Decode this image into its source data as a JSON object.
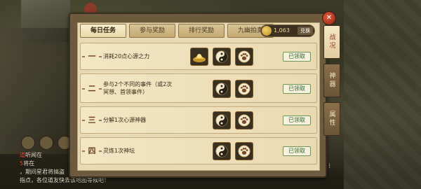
{
  "scene": {
    "chat": {
      "lines": [
        {
          "prefix": "道",
          "text": "听闻在",
          "red": "",
          "extra": ""
        },
        {
          "prefix": "5",
          "text": "将在",
          "red": "",
          "extra": ""
        },
        {
          "prefix": "",
          "text": "，期间星君将搞盗",
          "red": "",
          "extra": ""
        },
        {
          "prefix": "",
          "text": "指点，各位道友快去该地图等候吧！",
          "red": "",
          "extra": ""
        }
      ]
    }
  },
  "panel": {
    "tabs": [
      {
        "label": "每日任务",
        "active": true
      },
      {
        "label": "参与奖励",
        "active": false
      },
      {
        "label": "排行奖励",
        "active": false
      },
      {
        "label": "九幽拍卖",
        "active": false
      }
    ],
    "currency": {
      "value": "1,063",
      "button": "兑换"
    },
    "tasks": [
      {
        "num": "一",
        "title_lines": [
          "消耗20点心源之力"
        ],
        "rewards": [
          "gold-ingot-icon",
          "taiji-icon",
          "paw-icon"
        ],
        "claim": "已领取"
      },
      {
        "num": "二",
        "title_lines": [
          "参与2个不同的事件（或2次",
          "冥想、首领事件）"
        ],
        "rewards": [
          "taiji-icon",
          "paw-icon"
        ],
        "claim": "已领取"
      },
      {
        "num": "三",
        "title_lines": [
          "分解1次心源神器"
        ],
        "rewards": [
          "taiji-icon",
          "paw-icon"
        ],
        "claim": "已领取"
      },
      {
        "num": "四",
        "title_lines": [
          "灵炼1次神坛"
        ],
        "rewards": [
          "taiji-icon",
          "paw-icon"
        ],
        "claim": "已领取"
      }
    ]
  },
  "side_tabs": [
    {
      "label": "战况",
      "active": true
    },
    {
      "label": "神器",
      "active": false
    },
    {
      "label": "属性",
      "active": false
    }
  ],
  "close_label": "✕"
}
